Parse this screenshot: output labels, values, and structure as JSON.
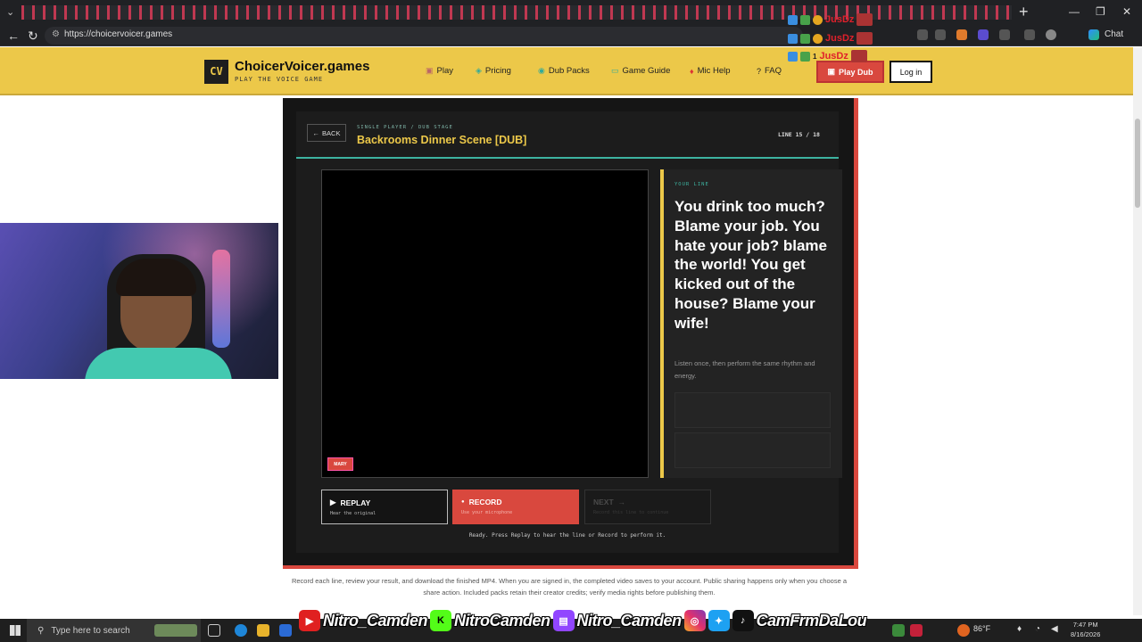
{
  "browser": {
    "url": "https://choicervoicer.games",
    "chat_label": "Chat",
    "new_tab_glyph": "+"
  },
  "header": {
    "logo_text": "CV",
    "brand": "ChoicerVoicer.games",
    "tagline": "PLAY THE VOICE GAME",
    "nav": [
      {
        "label": "Play",
        "icon": "gamepad-icon"
      },
      {
        "label": "Pricing",
        "icon": "tag-icon"
      },
      {
        "label": "Dub Packs",
        "icon": "package-icon"
      },
      {
        "label": "Game Guide",
        "icon": "book-icon"
      },
      {
        "label": "Mic Help",
        "icon": "microphone-icon"
      },
      {
        "label": "FAQ",
        "icon": "help-circle-icon"
      }
    ],
    "play_dub": "Play Dub",
    "login": "Log in"
  },
  "game": {
    "back": "BACK",
    "breadcrumb": "SINGLE PLAYER / DUB STAGE",
    "title": "Backrooms Dinner Scene [DUB]",
    "line_counter": "LINE 15 / 18",
    "video_badge": "MARY",
    "your_line_label": "YOUR LINE",
    "line_text": "You drink too much? Blame your job. You hate your job? blame the world! You get kicked out of the house? Blame your wife!",
    "hint": "Listen once, then perform the same rhythm and energy.",
    "replay_label": "REPLAY",
    "replay_sub": "Hear the original",
    "record_label": "RECORD",
    "record_sub": "Use your microphone",
    "next_label": "NEXT",
    "next_sub": "Record this line to continue",
    "status": "Ready. Press Replay to hear the line or Record to perform it."
  },
  "footer_note": "Record each line, review your result, and download the finished MP4. When you are signed in, the completed video saves to your account. Public sharing happens only when you choose a share action. Included packs retain their creator credits; verify media rights before publishing them.",
  "overlay": {
    "alerts": [
      {
        "rank": "",
        "name": "JusDz"
      },
      {
        "rank": "",
        "name": "JusDz"
      },
      {
        "rank": "1",
        "name": "JusDz"
      }
    ],
    "socials": [
      {
        "icon": "youtube-icon",
        "handle": "Nitro_Camden"
      },
      {
        "icon": "kick-icon",
        "handle": "NitroCamden"
      },
      {
        "icon": "twitch-icon",
        "handle": "Nitro_Camden"
      },
      {
        "icon": "instagram-icon",
        "handle": ""
      },
      {
        "icon": "twitter-icon",
        "handle": ""
      },
      {
        "icon": "tiktok-icon",
        "handle": "CamFrmDaLou"
      }
    ]
  },
  "taskbar": {
    "search_placeholder": "Type here to search",
    "weather": "86°F",
    "time": "7:47 PM",
    "date": "8/16/2026"
  },
  "colors": {
    "brand_yellow": "#ecc849",
    "accent_red": "#d9483e",
    "accent_teal": "#3db3a0"
  }
}
